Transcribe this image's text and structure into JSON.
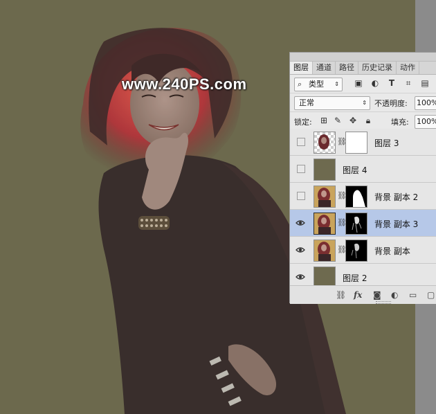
{
  "watermark": "www.240PS.com",
  "panel": {
    "tabs": [
      "图层",
      "通道",
      "路径",
      "历史记录",
      "动作"
    ],
    "active_tab": 0,
    "filter_kind": "类型",
    "blend_mode": "正常",
    "opacity_label": "不透明度:",
    "opacity_value": "100%",
    "lock_label": "锁定:",
    "fill_label": "填充:",
    "fill_value": "100%",
    "layers": [
      {
        "name": "图层 3",
        "visible": false,
        "selected": false
      },
      {
        "name": "图层 4",
        "visible": false,
        "selected": false
      },
      {
        "name": "背景 副本 2",
        "visible": false,
        "selected": false
      },
      {
        "name": "背景 副本 3",
        "visible": true,
        "selected": true
      },
      {
        "name": "背景 副本",
        "visible": true,
        "selected": false
      },
      {
        "name": "图层 2",
        "visible": true,
        "selected": false
      }
    ],
    "bottom_icons": [
      "link-icon",
      "fx-icon",
      "add-mask-icon",
      "adjustment-icon",
      "group-folder-icon",
      "new-layer-icon"
    ],
    "fx_label": "fx"
  },
  "colors": {
    "canvas_bg": "#6d694e",
    "selected_layer": "#b6c8e8",
    "olive_fill": "#6e6a4f"
  }
}
